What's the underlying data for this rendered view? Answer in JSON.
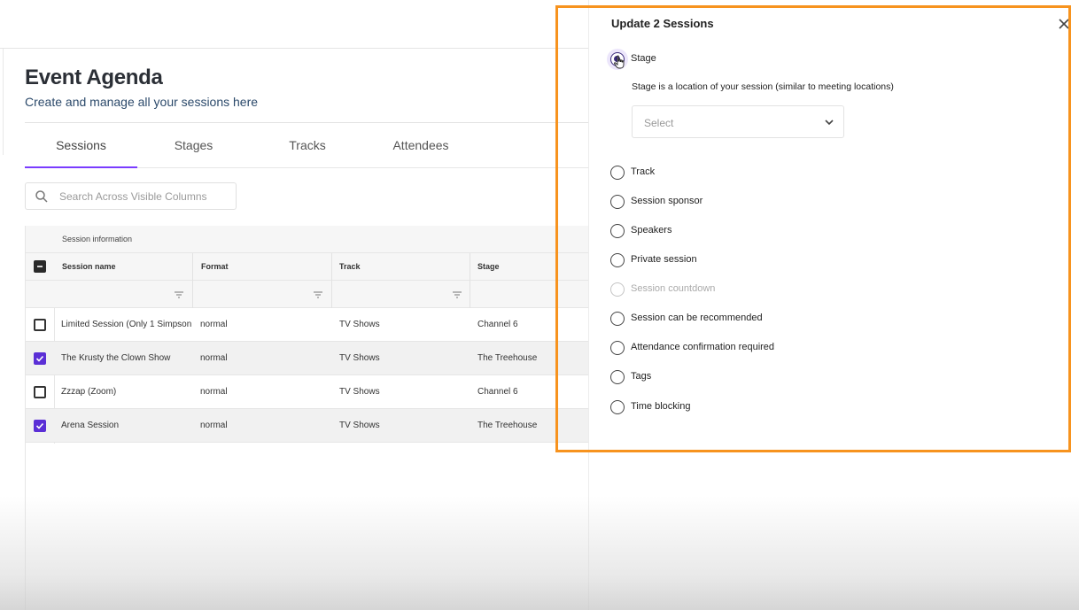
{
  "page": {
    "title": "Event Agenda",
    "subtitle": "Create and manage all your sessions here"
  },
  "tabs": [
    {
      "label": "Sessions",
      "active": true
    },
    {
      "label": "Stages",
      "active": false
    },
    {
      "label": "Tracks",
      "active": false
    },
    {
      "label": "Attendees",
      "active": false
    }
  ],
  "search": {
    "placeholder": "Search Across Visible Columns"
  },
  "table": {
    "group_header": "Session information",
    "select_all_state": "indeterminate",
    "columns": [
      "Session name",
      "Format",
      "Track",
      "Stage"
    ],
    "rows": [
      {
        "name": "Limited Session (Only 1 Simpson",
        "format": "normal",
        "track": "TV Shows",
        "stage": "Channel 6",
        "selected": false
      },
      {
        "name": "The Krusty the Clown Show",
        "format": "normal",
        "track": "TV Shows",
        "stage": "The Treehouse",
        "selected": true
      },
      {
        "name": "Zzzap (Zoom)",
        "format": "normal",
        "track": "TV Shows",
        "stage": "Channel 6",
        "selected": false
      },
      {
        "name": "Arena Session",
        "format": "normal",
        "track": "TV Shows",
        "stage": "The Treehouse",
        "selected": true
      }
    ]
  },
  "panel": {
    "title": "Update 2 Sessions",
    "close_icon": "close-icon",
    "stage_option": "Stage",
    "stage_description": "Stage is a location of your session (similar to meeting locations)",
    "stage_select_placeholder": "Select",
    "options": [
      {
        "label": "Track",
        "disabled": false
      },
      {
        "label": "Session sponsor",
        "disabled": false
      },
      {
        "label": "Speakers",
        "disabled": false
      },
      {
        "label": "Private session",
        "disabled": false
      },
      {
        "label": "Session countdown",
        "disabled": true
      },
      {
        "label": "Session can be recommended",
        "disabled": false
      },
      {
        "label": "Attendance confirmation required",
        "disabled": false
      },
      {
        "label": "Tags",
        "disabled": false
      },
      {
        "label": "Time blocking",
        "disabled": false
      }
    ]
  },
  "colors": {
    "accent": "#7a3cff",
    "checkbox_checked": "#5b2fd6",
    "highlight_frame": "#f7931e"
  }
}
